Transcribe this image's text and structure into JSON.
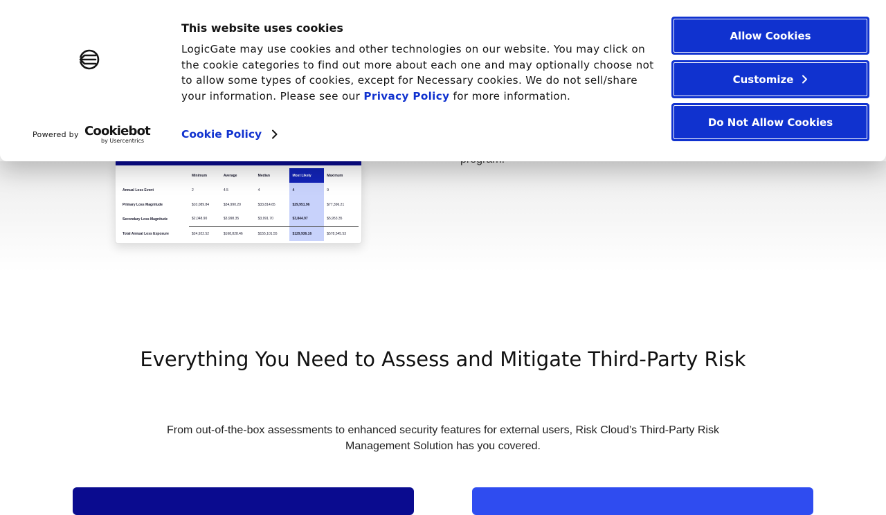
{
  "cookie_banner": {
    "title": "This website uses cookies",
    "body_text": "LogicGate may use cookies and other technologies on our website. You may click on the cookie categories to find out more about each one and may optionally choose not to allow some types of cookies, except for Necessary cookies.  We do not sell/share your information. Please see our ",
    "privacy_link": "Privacy Policy",
    "body_suffix": " for more information.",
    "cookie_policy_link": "Cookie Policy",
    "powered_by": "Powered by",
    "provider_name": "Cookiebot",
    "provider_sub": "by Usercentrics",
    "buttons": {
      "allow": "Allow Cookies",
      "customize": "Customize",
      "deny": "Do Not Allow Cookies"
    },
    "accent_color": "#1032cf"
  },
  "hero": {
    "text_fragment": "program.",
    "loss_table": {
      "headers": [
        "",
        "Minimum",
        "Average",
        "Median",
        "Most Likely",
        "Maximum"
      ],
      "rows": [
        [
          "Annual Loss Event",
          "2",
          "4.5",
          "4",
          "4",
          "9"
        ],
        [
          "Primary Loss Magnitude",
          "$10,089.84",
          "$34,990.20",
          "$33,814.65",
          "$29,951.96",
          "$77,396.21"
        ],
        [
          "Secondary Loss Magnitude",
          "$2,048.90",
          "$3,998.35",
          "$3,991.70",
          "$3,844.97",
          "$5,953.35"
        ],
        [
          "Total Annual Loss Exposure",
          "$24,922.52",
          "$168,828.46",
          "$155,101.55",
          "$129,936.16",
          "$578,545.53"
        ]
      ]
    }
  },
  "section": {
    "title": "Everything You Need to Assess and Mitigate Third-Party Risk",
    "subtitle": "From out-of-the-box assessments to enhanced security features for external users, Risk Cloud’s Third-Party Risk Management Solution has you covered."
  },
  "icons": {
    "brand_logo": "logicgate-logo-icon",
    "chevron": "chevron-right-icon"
  },
  "colors": {
    "navy_card": "#0a0b8f",
    "blue_card": "#2f4cf0",
    "highlight_column": "#1324b8"
  }
}
